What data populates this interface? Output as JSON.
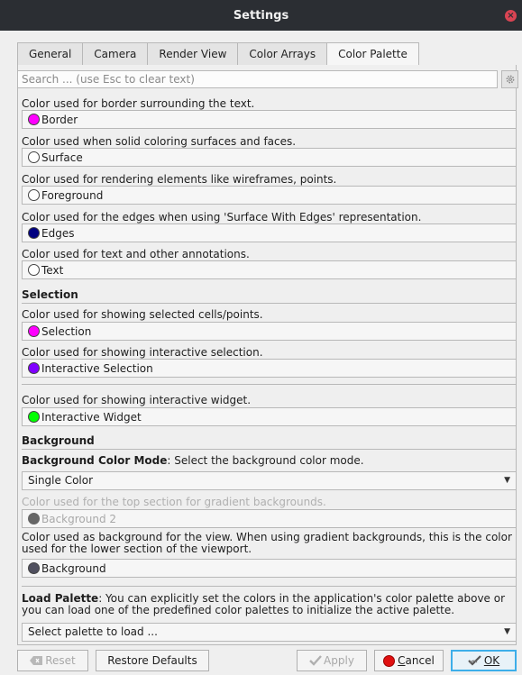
{
  "window": {
    "title": "Settings",
    "close_glyph": "×"
  },
  "tabs": [
    {
      "label": "General"
    },
    {
      "label": "Camera"
    },
    {
      "label": "Render View"
    },
    {
      "label": "Color Arrays"
    },
    {
      "label": "Color Palette",
      "active": true
    }
  ],
  "search": {
    "placeholder": "Search ... (use Esc to clear text)",
    "value": ""
  },
  "icons": {
    "settings": "gear-icon",
    "reset": "clear-icon",
    "apply": "check-icon",
    "cancel": "cancel-icon",
    "ok": "ok-icon"
  },
  "colors": {
    "magenta": "#ff00ff",
    "white": "#ffffff",
    "navy": "#000080",
    "purple": "#8000ff",
    "green": "#00ff00",
    "gray": "#666666",
    "slate": "#50505f",
    "accent": "#3daee9"
  },
  "palette": {
    "border": {
      "desc": "Color used for border surrounding the text.",
      "label": "Border"
    },
    "surface": {
      "desc": "Color used when solid coloring surfaces and faces.",
      "label": "Surface"
    },
    "foreground": {
      "desc": "Color used for rendering elements like wireframes, points.",
      "label": "Foreground"
    },
    "edges": {
      "desc": "Color used for the edges when using 'Surface With Edges' representation.",
      "label": "Edges"
    },
    "text": {
      "desc": "Color used for text and other annotations.",
      "label": "Text"
    }
  },
  "selection": {
    "heading": "Selection",
    "selection": {
      "desc": "Color used for showing selected cells/points.",
      "label": "Selection"
    },
    "interactive_selection": {
      "desc": "Color used for showing interactive selection.",
      "label": "Interactive Selection"
    },
    "interactive_widget": {
      "desc": "Color used for showing interactive widget.",
      "label": "Interactive Widget"
    }
  },
  "background": {
    "heading": "Background",
    "mode_bold": "Background Color Mode",
    "mode_desc": ": Select the background color mode.",
    "mode_value": "Single Color",
    "bg2_desc": "Color used for the top section for gradient backgrounds.",
    "bg2_label": "Background 2",
    "bg_desc": "Color used as background for the view. When using gradient backgrounds, this is the color used for the lower section of the viewport.",
    "bg_label": "Background"
  },
  "load_palette": {
    "bold": "Load Palette",
    "desc": ": You can explicitly set the colors in the application's color palette above or you can load one of the predefined color palettes to initialize the active palette.",
    "value": "Select palette to load ..."
  },
  "buttons": {
    "reset": "Reset",
    "restore": "Restore Defaults",
    "apply": "Apply",
    "cancel_u": "C",
    "cancel_rest": "ancel",
    "ok": "OK"
  }
}
